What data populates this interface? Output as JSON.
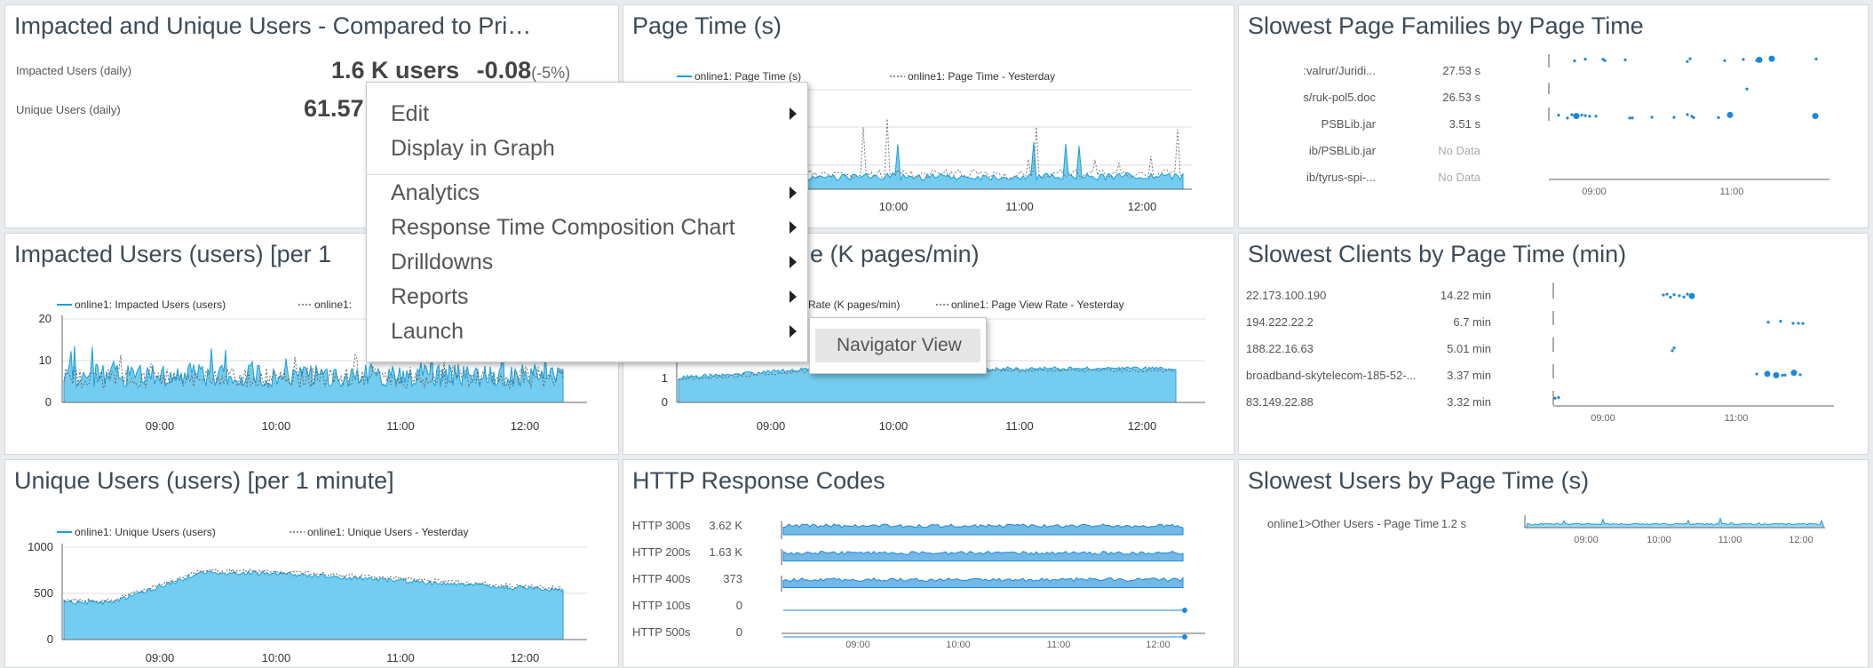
{
  "panels": {
    "impacted_unique": {
      "title": "Impacted and Unique Users - Compared to Pri…",
      "impacted_label": "Impacted Users (daily)",
      "impacted_value": "1.6 K users",
      "impacted_delta": "-0.08",
      "impacted_pct": "(-5%)",
      "unique_label": "Unique Users (daily)",
      "unique_value": "61.57"
    },
    "page_time": {
      "title": "Page Time (s)",
      "legend1": "online1: Page Time (s)",
      "legend2": "online1: Page Time - Yesterday",
      "xticks": [
        "10:00",
        "11:00",
        "12:00"
      ]
    },
    "slowest_families": {
      "title": "Slowest Page Families by Page Time",
      "rows": [
        {
          "name": ":valrur/Juridi...",
          "value": "27.53 s"
        },
        {
          "name": "s/ruk-pol5.doc",
          "value": "26.53 s"
        },
        {
          "name": "PSBLib.jar",
          "value": "3.51 s"
        },
        {
          "name": "ib/PSBLib.jar",
          "value": "No Data"
        },
        {
          "name": "ib/tyrus-spi-...",
          "value": "No Data"
        }
      ],
      "xticks": [
        "09:00",
        "11:00"
      ]
    },
    "impacted_users": {
      "title": "Impacted Users (users) [per 1",
      "legend1": "online1: Impacted Users (users)",
      "legend2": "online1:",
      "yticks": [
        "20",
        "10",
        "0"
      ],
      "xticks": [
        "09:00",
        "10:00",
        "11:00",
        "12:00"
      ]
    },
    "page_view": {
      "title": "e (K pages/min)",
      "legend1": "Rate (K pages/min)",
      "legend2": "online1: Page View Rate - Yesterday",
      "yticks": [
        "1",
        "0"
      ],
      "xticks": [
        "09:00",
        "10:00",
        "11:00",
        "12:00"
      ]
    },
    "slowest_clients": {
      "title": "Slowest Clients by Page Time (min)",
      "rows": [
        {
          "name": "22.173.100.190",
          "value": "14.22 min"
        },
        {
          "name": "194.222.22.2",
          "value": "6.7 min"
        },
        {
          "name": "188.22.16.63",
          "value": "5.01 min"
        },
        {
          "name": "broadband-skytelecom-185-52-...",
          "value": "3.37 min"
        },
        {
          "name": "83.149.22.88",
          "value": "3.32 min"
        }
      ],
      "xticks": [
        "09:00",
        "11:00"
      ]
    },
    "unique_users": {
      "title": "Unique Users (users) [per 1 minute]",
      "legend1": "online1: Unique Users (users)",
      "legend2": "online1: Unique Users - Yesterday",
      "yticks": [
        "1000",
        "500",
        "0"
      ],
      "xticks": [
        "09:00",
        "10:00",
        "11:00",
        "12:00"
      ]
    },
    "http_codes": {
      "title": "HTTP Response Codes",
      "rows": [
        {
          "name": "HTTP 300s",
          "value": "3.62 K"
        },
        {
          "name": "HTTP 200s",
          "value": "1.63 K"
        },
        {
          "name": "HTTP 400s",
          "value": "373"
        },
        {
          "name": "HTTP 100s",
          "value": "0"
        },
        {
          "name": "HTTP 500s",
          "value": "0"
        }
      ],
      "xticks": [
        "09:00",
        "10:00",
        "11:00",
        "12:00"
      ]
    },
    "slowest_users": {
      "title": "Slowest Users by Page Time (s)",
      "row_name": "online1>Other Users - Page Time",
      "row_value": "1.2 s",
      "xticks": [
        "09:00",
        "10:00",
        "11:00",
        "12:00"
      ]
    }
  },
  "context_menu": {
    "items": [
      "Edit",
      "Display in Graph",
      "Analytics",
      "Response Time Composition Chart",
      "Drilldowns",
      "Reports",
      "Launch"
    ],
    "submenu_item": "Navigator View"
  },
  "colors": {
    "series_fill": "#74cdf0",
    "series_line": "#1a9fd8",
    "marker": "#1e88d9",
    "panel_title": "#3d4b57"
  }
}
